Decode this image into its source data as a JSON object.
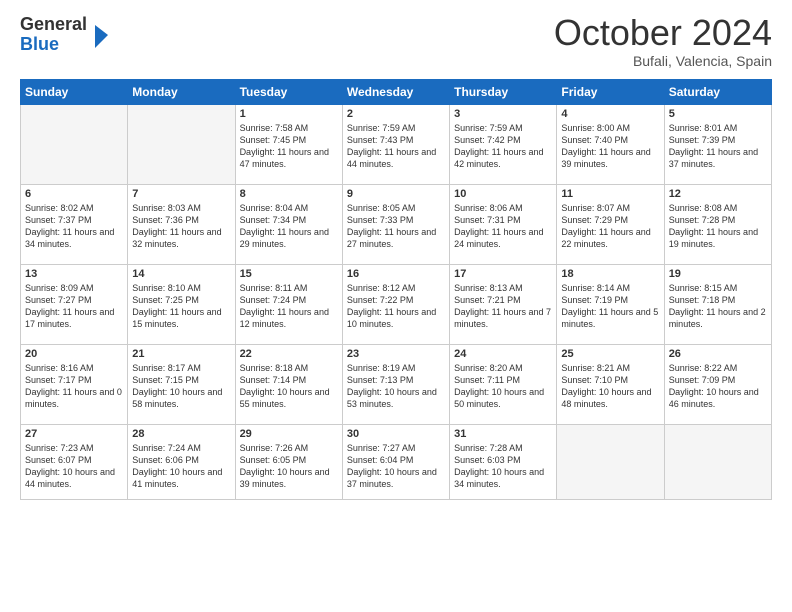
{
  "header": {
    "logo_general": "General",
    "logo_blue": "Blue",
    "month_title": "October 2024",
    "location": "Bufali, Valencia, Spain"
  },
  "weekdays": [
    "Sunday",
    "Monday",
    "Tuesday",
    "Wednesday",
    "Thursday",
    "Friday",
    "Saturday"
  ],
  "weeks": [
    [
      {
        "day": "",
        "info": ""
      },
      {
        "day": "",
        "info": ""
      },
      {
        "day": "1",
        "info": "Sunrise: 7:58 AM\nSunset: 7:45 PM\nDaylight: 11 hours and 47 minutes."
      },
      {
        "day": "2",
        "info": "Sunrise: 7:59 AM\nSunset: 7:43 PM\nDaylight: 11 hours and 44 minutes."
      },
      {
        "day": "3",
        "info": "Sunrise: 7:59 AM\nSunset: 7:42 PM\nDaylight: 11 hours and 42 minutes."
      },
      {
        "day": "4",
        "info": "Sunrise: 8:00 AM\nSunset: 7:40 PM\nDaylight: 11 hours and 39 minutes."
      },
      {
        "day": "5",
        "info": "Sunrise: 8:01 AM\nSunset: 7:39 PM\nDaylight: 11 hours and 37 minutes."
      }
    ],
    [
      {
        "day": "6",
        "info": "Sunrise: 8:02 AM\nSunset: 7:37 PM\nDaylight: 11 hours and 34 minutes."
      },
      {
        "day": "7",
        "info": "Sunrise: 8:03 AM\nSunset: 7:36 PM\nDaylight: 11 hours and 32 minutes."
      },
      {
        "day": "8",
        "info": "Sunrise: 8:04 AM\nSunset: 7:34 PM\nDaylight: 11 hours and 29 minutes."
      },
      {
        "day": "9",
        "info": "Sunrise: 8:05 AM\nSunset: 7:33 PM\nDaylight: 11 hours and 27 minutes."
      },
      {
        "day": "10",
        "info": "Sunrise: 8:06 AM\nSunset: 7:31 PM\nDaylight: 11 hours and 24 minutes."
      },
      {
        "day": "11",
        "info": "Sunrise: 8:07 AM\nSunset: 7:29 PM\nDaylight: 11 hours and 22 minutes."
      },
      {
        "day": "12",
        "info": "Sunrise: 8:08 AM\nSunset: 7:28 PM\nDaylight: 11 hours and 19 minutes."
      }
    ],
    [
      {
        "day": "13",
        "info": "Sunrise: 8:09 AM\nSunset: 7:27 PM\nDaylight: 11 hours and 17 minutes."
      },
      {
        "day": "14",
        "info": "Sunrise: 8:10 AM\nSunset: 7:25 PM\nDaylight: 11 hours and 15 minutes."
      },
      {
        "day": "15",
        "info": "Sunrise: 8:11 AM\nSunset: 7:24 PM\nDaylight: 11 hours and 12 minutes."
      },
      {
        "day": "16",
        "info": "Sunrise: 8:12 AM\nSunset: 7:22 PM\nDaylight: 11 hours and 10 minutes."
      },
      {
        "day": "17",
        "info": "Sunrise: 8:13 AM\nSunset: 7:21 PM\nDaylight: 11 hours and 7 minutes."
      },
      {
        "day": "18",
        "info": "Sunrise: 8:14 AM\nSunset: 7:19 PM\nDaylight: 11 hours and 5 minutes."
      },
      {
        "day": "19",
        "info": "Sunrise: 8:15 AM\nSunset: 7:18 PM\nDaylight: 11 hours and 2 minutes."
      }
    ],
    [
      {
        "day": "20",
        "info": "Sunrise: 8:16 AM\nSunset: 7:17 PM\nDaylight: 11 hours and 0 minutes."
      },
      {
        "day": "21",
        "info": "Sunrise: 8:17 AM\nSunset: 7:15 PM\nDaylight: 10 hours and 58 minutes."
      },
      {
        "day": "22",
        "info": "Sunrise: 8:18 AM\nSunset: 7:14 PM\nDaylight: 10 hours and 55 minutes."
      },
      {
        "day": "23",
        "info": "Sunrise: 8:19 AM\nSunset: 7:13 PM\nDaylight: 10 hours and 53 minutes."
      },
      {
        "day": "24",
        "info": "Sunrise: 8:20 AM\nSunset: 7:11 PM\nDaylight: 10 hours and 50 minutes."
      },
      {
        "day": "25",
        "info": "Sunrise: 8:21 AM\nSunset: 7:10 PM\nDaylight: 10 hours and 48 minutes."
      },
      {
        "day": "26",
        "info": "Sunrise: 8:22 AM\nSunset: 7:09 PM\nDaylight: 10 hours and 46 minutes."
      }
    ],
    [
      {
        "day": "27",
        "info": "Sunrise: 7:23 AM\nSunset: 6:07 PM\nDaylight: 10 hours and 44 minutes."
      },
      {
        "day": "28",
        "info": "Sunrise: 7:24 AM\nSunset: 6:06 PM\nDaylight: 10 hours and 41 minutes."
      },
      {
        "day": "29",
        "info": "Sunrise: 7:26 AM\nSunset: 6:05 PM\nDaylight: 10 hours and 39 minutes."
      },
      {
        "day": "30",
        "info": "Sunrise: 7:27 AM\nSunset: 6:04 PM\nDaylight: 10 hours and 37 minutes."
      },
      {
        "day": "31",
        "info": "Sunrise: 7:28 AM\nSunset: 6:03 PM\nDaylight: 10 hours and 34 minutes."
      },
      {
        "day": "",
        "info": ""
      },
      {
        "day": "",
        "info": ""
      }
    ]
  ]
}
